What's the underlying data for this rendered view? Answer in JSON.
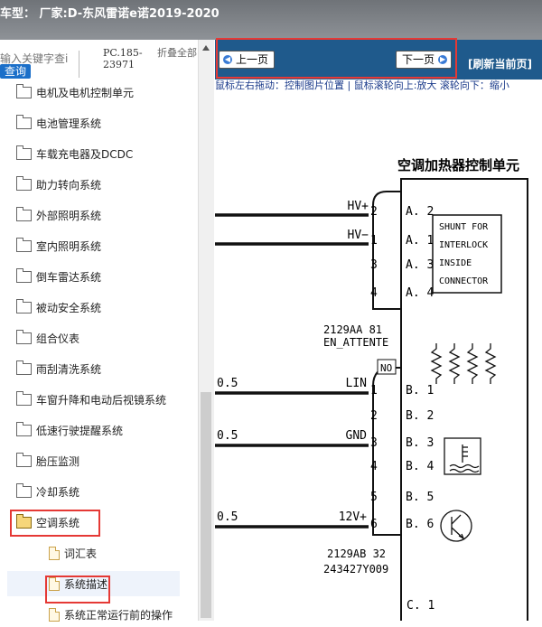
{
  "window": {
    "title": "车型：  厂家:D-东风雷诺e诺2019-2020"
  },
  "search": {
    "placeholder": "输入关键字查i",
    "button": "查询",
    "pc_code": "PC.185-23971",
    "fold_all": "折叠全部"
  },
  "tree": {
    "items": [
      {
        "label": "电机及电机控制单元",
        "type": "folder"
      },
      {
        "label": "电池管理系统",
        "type": "folder"
      },
      {
        "label": "车载充电器及DCDC",
        "type": "folder"
      },
      {
        "label": "助力转向系统",
        "type": "folder"
      },
      {
        "label": "外部照明系统",
        "type": "folder"
      },
      {
        "label": "室内照明系统",
        "type": "folder"
      },
      {
        "label": "倒车雷达系统",
        "type": "folder"
      },
      {
        "label": "被动安全系统",
        "type": "folder"
      },
      {
        "label": "组合仪表",
        "type": "folder"
      },
      {
        "label": "雨刮清洗系统",
        "type": "folder"
      },
      {
        "label": "车窗升降和电动后视镜系统",
        "type": "folder"
      },
      {
        "label": "低速行驶提醒系统",
        "type": "folder"
      },
      {
        "label": "胎压监测",
        "type": "folder"
      },
      {
        "label": "冷却系统",
        "type": "folder"
      },
      {
        "label": "空调系统",
        "type": "folder-open"
      },
      {
        "label": "词汇表",
        "type": "doc"
      },
      {
        "label": "系统描述",
        "type": "doc"
      },
      {
        "label": "系统正常运行前的操作",
        "type": "doc"
      }
    ]
  },
  "toolbar": {
    "prev": "上一页",
    "next": "下一页",
    "refresh": "[刷新当前页]"
  },
  "hint": "鼠标左右拖动：控制图片位置 | 鼠标滚轮向上:放大   滚轮向下：缩小",
  "diagram": {
    "title": "空调加热器控制单元",
    "conn1": {
      "pins": [
        {
          "wire": "HV+",
          "num": "2",
          "port": "A. 2"
        },
        {
          "wire": "HV−",
          "num": "1",
          "port": "A. 1"
        },
        {
          "wire": "",
          "num": "3",
          "port": "A. 3"
        },
        {
          "wire": "",
          "num": "4",
          "port": "A. 4"
        }
      ],
      "label1": "2129AA  81",
      "label2": "EN_ATTENTE"
    },
    "shunt": [
      "SHUNT FOR",
      "INTERLOCK",
      "INSIDE",
      "CONNECTOR"
    ],
    "no_badge": "NO",
    "conn2": {
      "pins": [
        {
          "wire": "LIN",
          "num": "1",
          "port": "B. 1",
          "gauge": "0.5"
        },
        {
          "wire": "",
          "num": "2",
          "port": "B. 2",
          "gauge": ""
        },
        {
          "wire": "GND",
          "num": "3",
          "port": "B. 3",
          "gauge": "0.5"
        },
        {
          "wire": "",
          "num": "4",
          "port": "B. 4",
          "gauge": ""
        },
        {
          "wire": "",
          "num": "5",
          "port": "B. 5",
          "gauge": ""
        },
        {
          "wire": "12V+",
          "num": "6",
          "port": "B. 6",
          "gauge": "0.5"
        }
      ],
      "label1": "2129AB  32",
      "label2": "243427Y009"
    },
    "c1_port": "C. 1"
  }
}
